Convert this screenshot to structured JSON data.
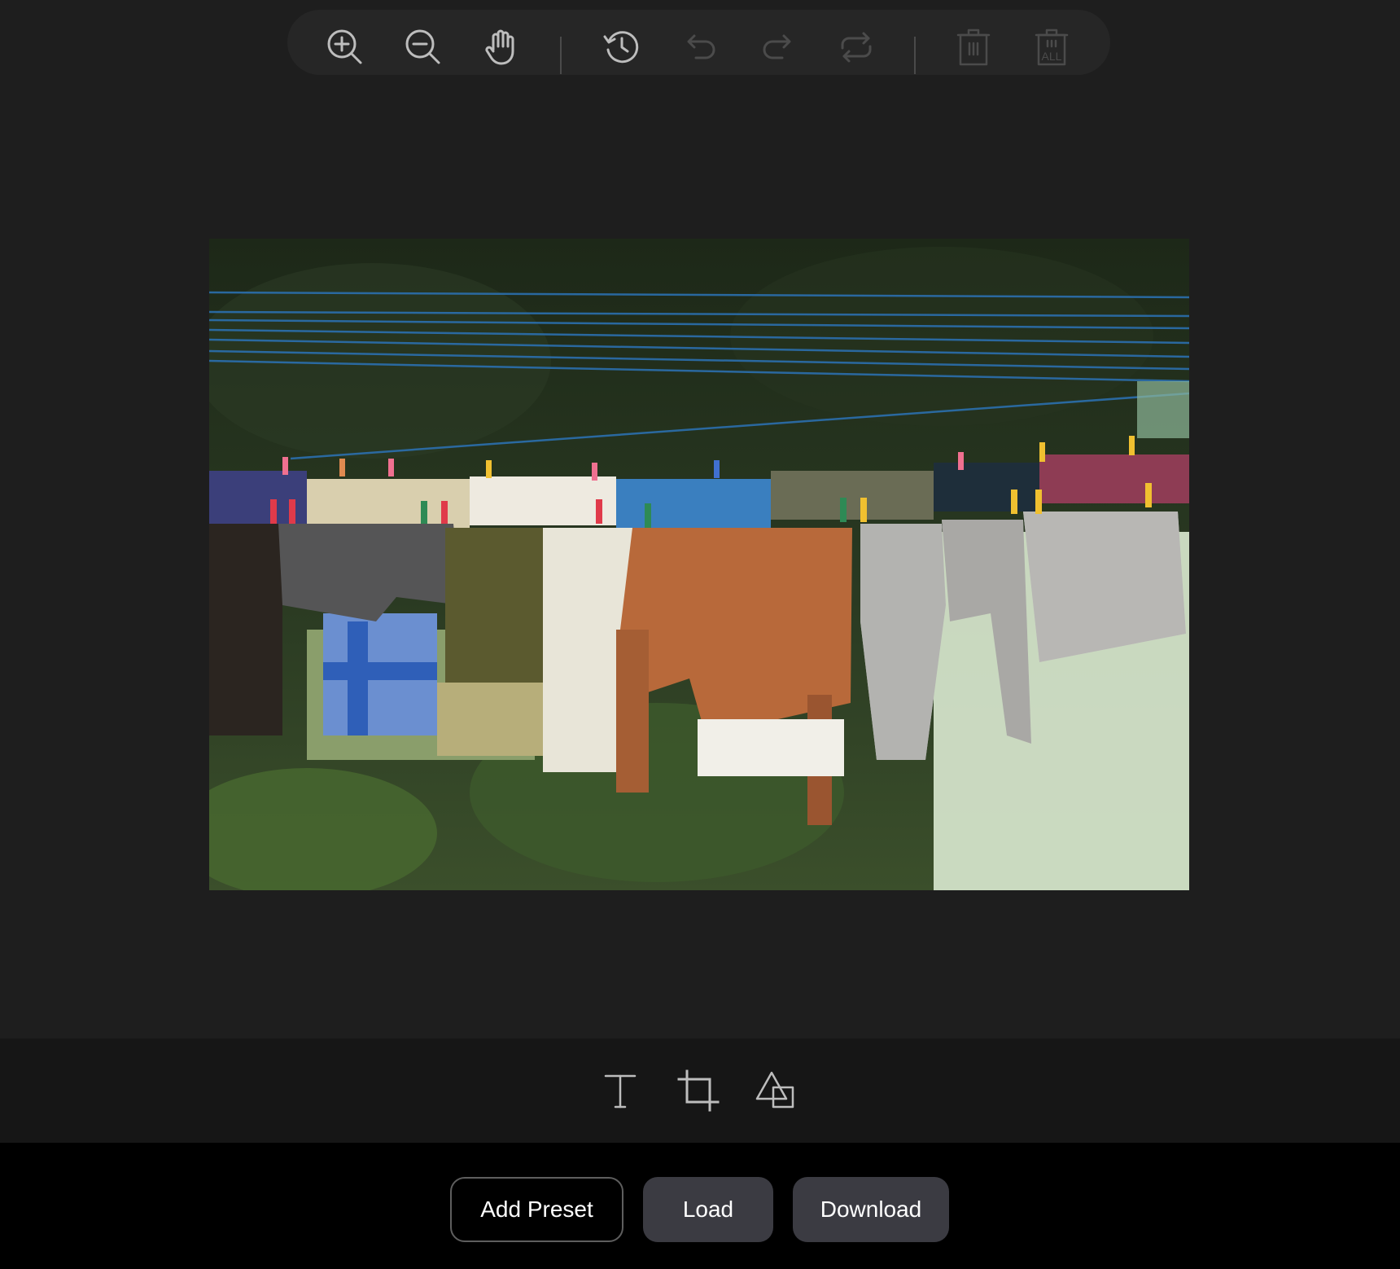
{
  "toolbar": {
    "icons": [
      "zoom-in-icon",
      "zoom-out-icon",
      "hand-icon",
      "history-icon",
      "undo-icon",
      "redo-icon",
      "reset-icon",
      "delete-icon",
      "delete-all-icon"
    ],
    "delete_all_text": "ALL"
  },
  "photo": {
    "subject": "clothes-drying-on-line"
  },
  "tools": {
    "icons": [
      "text-icon",
      "crop-icon",
      "shape-icon"
    ]
  },
  "footer": {
    "add_preset_label": "Add Preset",
    "load_label": "Load",
    "download_label": "Download"
  },
  "colors": {
    "background": "#1e1e1e",
    "toolbar": "#262626",
    "tools_bar": "#161616",
    "footer": "#000000",
    "button_fill": "#3b3b42",
    "icon_active": "#bdbdbd",
    "icon_disabled": "#4b4b4b"
  }
}
